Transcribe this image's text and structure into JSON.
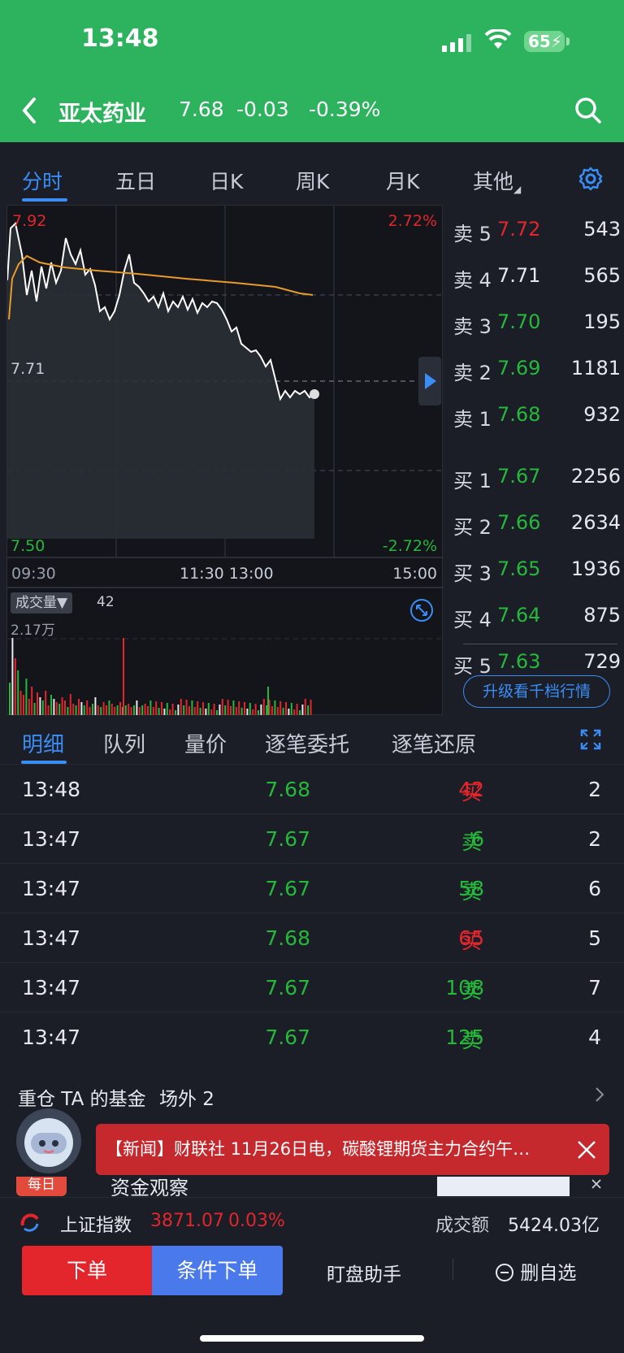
{
  "status": {
    "time": "13:48",
    "battery": "65"
  },
  "header": {
    "stock_name": "亚太药业",
    "price": "7.68",
    "change": "-0.03",
    "change_pct": "-0.39%"
  },
  "chart_tabs": [
    "分时",
    "五日",
    "日K",
    "周K",
    "月K",
    "其他"
  ],
  "chart": {
    "high": "7.92",
    "high_pct": "2.72%",
    "mid": "7.71",
    "low": "7.50",
    "low_pct": "-2.72%",
    "times": [
      "09:30",
      "11:30 13:00",
      "15:00"
    ],
    "volume_label": "成交量▼",
    "volume_value": "42",
    "volume_max": "2.17万"
  },
  "order_book": {
    "asks": [
      {
        "label": "卖 5",
        "price": "7.72",
        "color": "red",
        "vol": "543"
      },
      {
        "label": "卖 4",
        "price": "7.71",
        "color": "white",
        "vol": "565"
      },
      {
        "label": "卖 3",
        "price": "7.70",
        "color": "green",
        "vol": "195"
      },
      {
        "label": "卖 2",
        "price": "7.69",
        "color": "green",
        "vol": "1181"
      },
      {
        "label": "卖 1",
        "price": "7.68",
        "color": "green",
        "vol": "932"
      }
    ],
    "bids": [
      {
        "label": "买 1",
        "price": "7.67",
        "color": "green",
        "vol": "2256"
      },
      {
        "label": "买 2",
        "price": "7.66",
        "color": "green",
        "vol": "2634"
      },
      {
        "label": "买 3",
        "price": "7.65",
        "color": "green",
        "vol": "1936"
      },
      {
        "label": "买 4",
        "price": "7.64",
        "color": "green",
        "vol": "875"
      },
      {
        "label": "买 5",
        "price": "7.63",
        "color": "green",
        "vol": "729"
      }
    ],
    "upgrade": "升级看千档行情"
  },
  "detail_tabs": [
    "明细",
    "队列",
    "量价",
    "逐笔委托",
    "逐笔还原"
  ],
  "ticks": [
    {
      "time": "13:48",
      "price": "7.68",
      "vol": "42",
      "side": "买",
      "count": "2"
    },
    {
      "time": "13:47",
      "price": "7.67",
      "vol": "6",
      "side": "卖",
      "count": "2"
    },
    {
      "time": "13:47",
      "price": "7.67",
      "vol": "58",
      "side": "卖",
      "count": "6"
    },
    {
      "time": "13:47",
      "price": "7.68",
      "vol": "65",
      "side": "买",
      "count": "5"
    },
    {
      "time": "13:47",
      "price": "7.67",
      "vol": "108",
      "side": "卖",
      "count": "7"
    },
    {
      "time": "13:47",
      "price": "7.67",
      "vol": "125",
      "side": "卖",
      "count": "4"
    }
  ],
  "funds": {
    "label": "重仓 TA 的基金",
    "outside": "场外 2"
  },
  "news": {
    "text": "【新闻】财联社 11月26日电，碳酸锂期货主力合约午…"
  },
  "peek": {
    "badge": "每日",
    "text": "资金观察"
  },
  "index_bar": {
    "name": "上证指数",
    "value": "3871.07",
    "pct": "0.03%",
    "turnover_label": "成交额",
    "turnover": "5424.03亿"
  },
  "bottom": {
    "order": "下单",
    "cond_order": "条件下单",
    "assistant": "盯盘助手",
    "remove": "删自选"
  },
  "colors": {
    "up": "#e2262b",
    "down": "#25b83a",
    "accent": "#3a8df5",
    "header": "#2db35d"
  }
}
